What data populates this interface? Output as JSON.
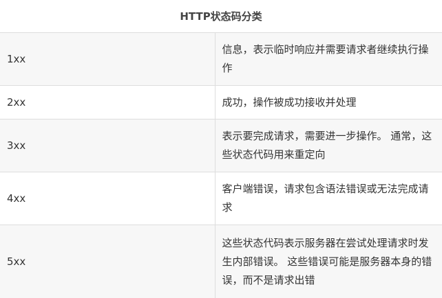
{
  "table": {
    "title": "HTTP状态码分类",
    "rows": [
      {
        "code": "1xx",
        "description": "信息，表示临时响应并需要请求者继续执行操作"
      },
      {
        "code": "2xx",
        "description": "成功，操作被成功接收并处理"
      },
      {
        "code": "3xx",
        "description": "表示要完成请求，需要进一步操作。 通常，这些状态代码用来重定向"
      },
      {
        "code": "4xx",
        "description": "客户端错误，请求包含语法错误或无法完成请求"
      },
      {
        "code": "5xx",
        "description": "这些状态代码表示服务器在尝试处理请求时发生内部错误。 这些错误可能是服务器本身的错误，而不是请求出错"
      }
    ]
  }
}
